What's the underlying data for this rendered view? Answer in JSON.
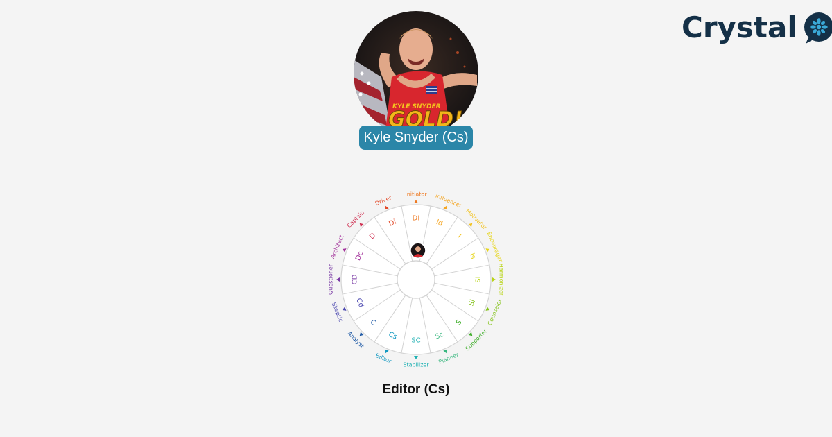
{
  "brand": {
    "name": "Crystal",
    "icon": "crystal-flower-icon",
    "color": "#143047"
  },
  "profile": {
    "name_label": "Kyle Snyder (Cs)",
    "photo_overlay_top": "KYLE SNYDER",
    "photo_overlay_main": "GOLD!"
  },
  "result": {
    "type_label": "Editor (Cs)"
  },
  "disc_wheel": {
    "selected_index": 16,
    "segments": [
      {
        "inner": "DI",
        "outer": "Initiator",
        "color": "#ee7a22"
      },
      {
        "inner": "Id",
        "outer": "Influencer",
        "color": "#f5a623"
      },
      {
        "inner": "I",
        "outer": "Motivator",
        "color": "#f2c21f"
      },
      {
        "inner": "Is",
        "outer": "Encourager",
        "color": "#e6d51c"
      },
      {
        "inner": "IS",
        "outer": "Harmonizer",
        "color": "#b9d418"
      },
      {
        "inner": "Si",
        "outer": "Counselor",
        "color": "#86c41e"
      },
      {
        "inner": "S",
        "outer": "Supporter",
        "color": "#3fae2a"
      },
      {
        "inner": "Sc",
        "outer": "Planner",
        "color": "#39b77f"
      },
      {
        "inner": "SC",
        "outer": "Stabilizer",
        "color": "#1fb1b3"
      },
      {
        "inner": "Cs",
        "outer": "Editor",
        "color": "#1499c1"
      },
      {
        "inner": "C",
        "outer": "Analyst",
        "color": "#1f5aa6"
      },
      {
        "inner": "Cd",
        "outer": "Skeptic",
        "color": "#4d4ab1"
      },
      {
        "inner": "CD",
        "outer": "Questioner",
        "color": "#7a3aa5"
      },
      {
        "inner": "Dc",
        "outer": "Architect",
        "color": "#a3339b"
      },
      {
        "inner": "D",
        "outer": "Captain",
        "color": "#cf2d4f"
      },
      {
        "inner": "Di",
        "outer": "Driver",
        "color": "#e34b2a"
      }
    ]
  }
}
